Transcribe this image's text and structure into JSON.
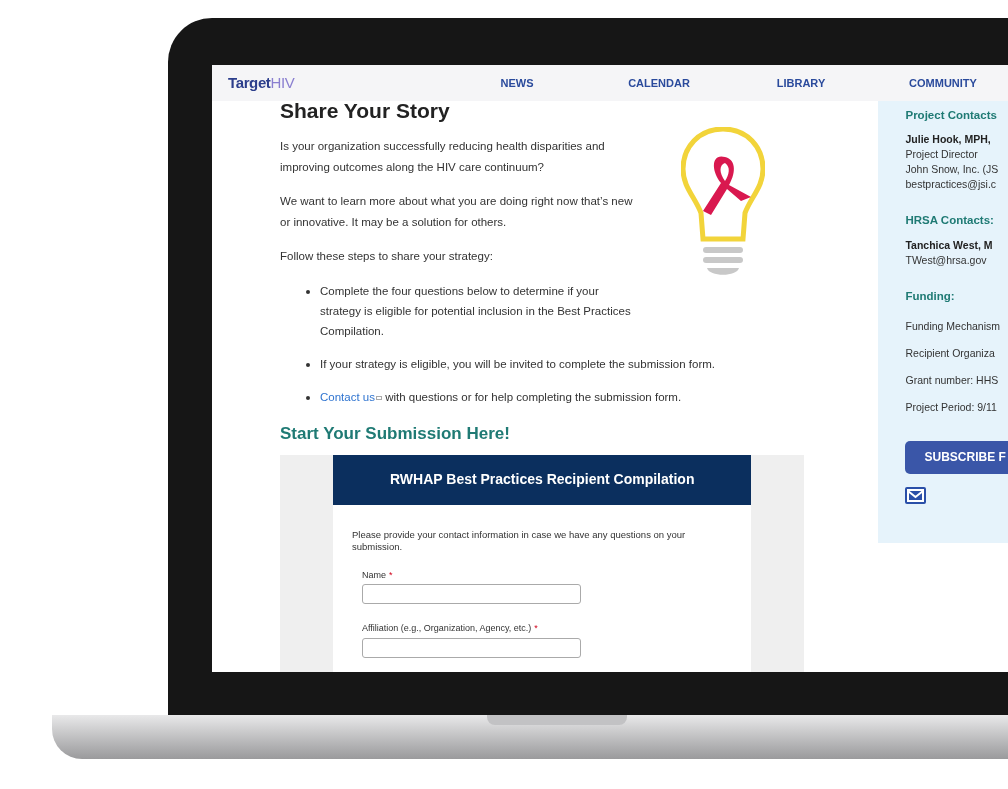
{
  "logo": {
    "main": "Target",
    "accent": "HIV"
  },
  "nav": [
    {
      "label": "NEWS"
    },
    {
      "label": "CALENDAR"
    },
    {
      "label": "LIBRARY"
    },
    {
      "label": "COMMUNITY"
    }
  ],
  "main": {
    "title": "Share Your Story",
    "paragraphs": [
      "Is your organization successfully reducing health disparities and improving outcomes along the HIV care continuum?",
      "We want to learn more about what you are doing right now that’s new or innovative. It may be a solution for others.",
      "Follow these steps to share your strategy:"
    ],
    "bullets": [
      {
        "text": "Complete the four questions below to determine if your strategy is eligible for potential inclusion in the Best Practices Compilation."
      },
      {
        "text": "If your strategy is eligible, you will be invited to complete the submission form."
      },
      {
        "link": "Contact us",
        "text": "with questions or for help completing the submission form."
      }
    ],
    "submission_heading": "Start Your Submission Here!"
  },
  "form": {
    "title": "RWHAP Best Practices Recipient Compilation",
    "intro": "Please provide your contact information in case we have any questions on your submission.",
    "fields": [
      {
        "label": "Name",
        "required_mark": "*"
      },
      {
        "label": "Affiliation (e.g., Organization, Agency, etc.)",
        "required_mark": "*"
      }
    ]
  },
  "sidebar": {
    "sections": [
      {
        "title": "Project Contacts",
        "entries": [
          {
            "kind": "name",
            "text": "Julie Hook, MPH,"
          },
          {
            "kind": "text",
            "text": "Project Director"
          },
          {
            "kind": "text",
            "text": "John Snow, Inc. (JS"
          },
          {
            "kind": "text",
            "text": "bestpractices@jsi.c"
          }
        ]
      },
      {
        "title": "HRSA Contacts:",
        "entries": [
          {
            "kind": "name",
            "text": "Tanchica West, M"
          },
          {
            "kind": "text",
            "text": "TWest@hrsa.gov"
          }
        ]
      },
      {
        "title": "Funding:",
        "entries": [
          {
            "kind": "item",
            "text": "Funding Mechanism"
          },
          {
            "kind": "item",
            "text": "Recipient Organiza"
          },
          {
            "kind": "item",
            "text": "Grant number: HHS"
          },
          {
            "kind": "item",
            "text": "Project Period: 9/11"
          }
        ]
      }
    ],
    "subscribe": "SUBSCRIBE F"
  }
}
